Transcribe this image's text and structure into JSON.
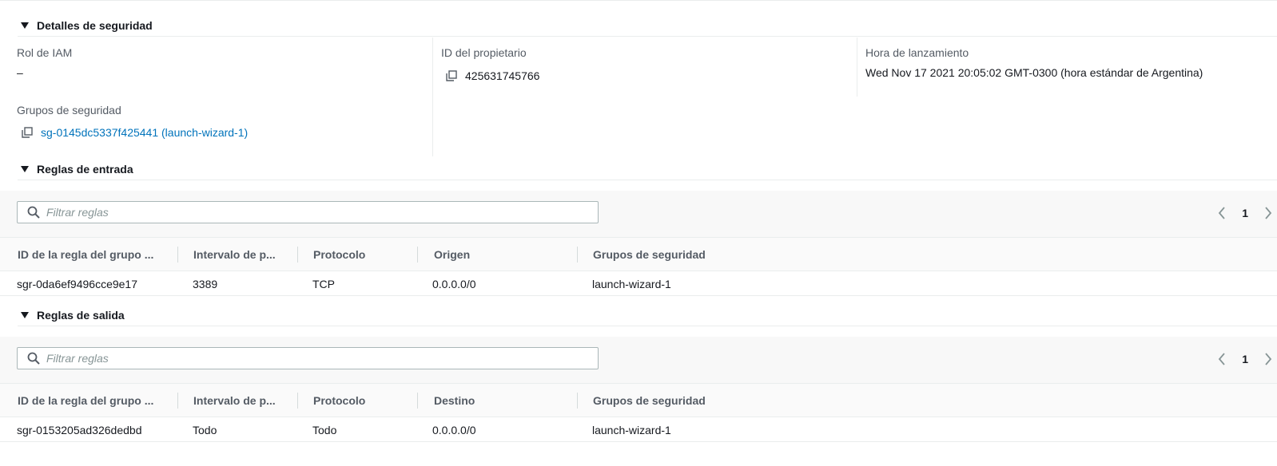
{
  "details": {
    "header": "Detalles de seguridad",
    "iam_role_label": "Rol de IAM",
    "iam_role_value": "–",
    "owner_id_label": "ID del propietario",
    "owner_id_value": "425631745766",
    "launch_time_label": "Hora de lanzamiento",
    "launch_time_value": "Wed Nov 17 2021 20:05:02 GMT-0300 (hora estándar de Argentina)",
    "security_groups_label": "Grupos de seguridad",
    "security_group_link": "sg-0145dc5337f425441 (launch-wizard-1)"
  },
  "inbound": {
    "header": "Reglas de entrada",
    "filter_placeholder": "Filtrar reglas",
    "page": "1",
    "columns": [
      "ID de la regla del grupo ...",
      "Intervalo de p...",
      "Protocolo",
      "Origen",
      "Grupos de seguridad"
    ],
    "rows": [
      [
        "sgr-0da6ef9496cce9e17",
        "3389",
        "TCP",
        "0.0.0.0/0",
        "launch-wizard-1"
      ]
    ]
  },
  "outbound": {
    "header": "Reglas de salida",
    "filter_placeholder": "Filtrar reglas",
    "page": "1",
    "columns": [
      "ID de la regla del grupo ...",
      "Intervalo de p...",
      "Protocolo",
      "Destino",
      "Grupos de seguridad"
    ],
    "rows": [
      [
        "sgr-0153205ad326dedbd",
        "Todo",
        "Todo",
        "0.0.0.0/0",
        "launch-wizard-1"
      ]
    ]
  },
  "colors": {
    "link": "#0073bb",
    "label": "#545b64",
    "text": "#16191f",
    "divider": "#eaeded",
    "filter_bg": "#f8f8f8"
  },
  "icons": {
    "caret": "caret-down-icon",
    "copy": "copy-icon",
    "search": "search-icon",
    "prev": "chevron-left-icon",
    "next": "chevron-right-icon"
  }
}
